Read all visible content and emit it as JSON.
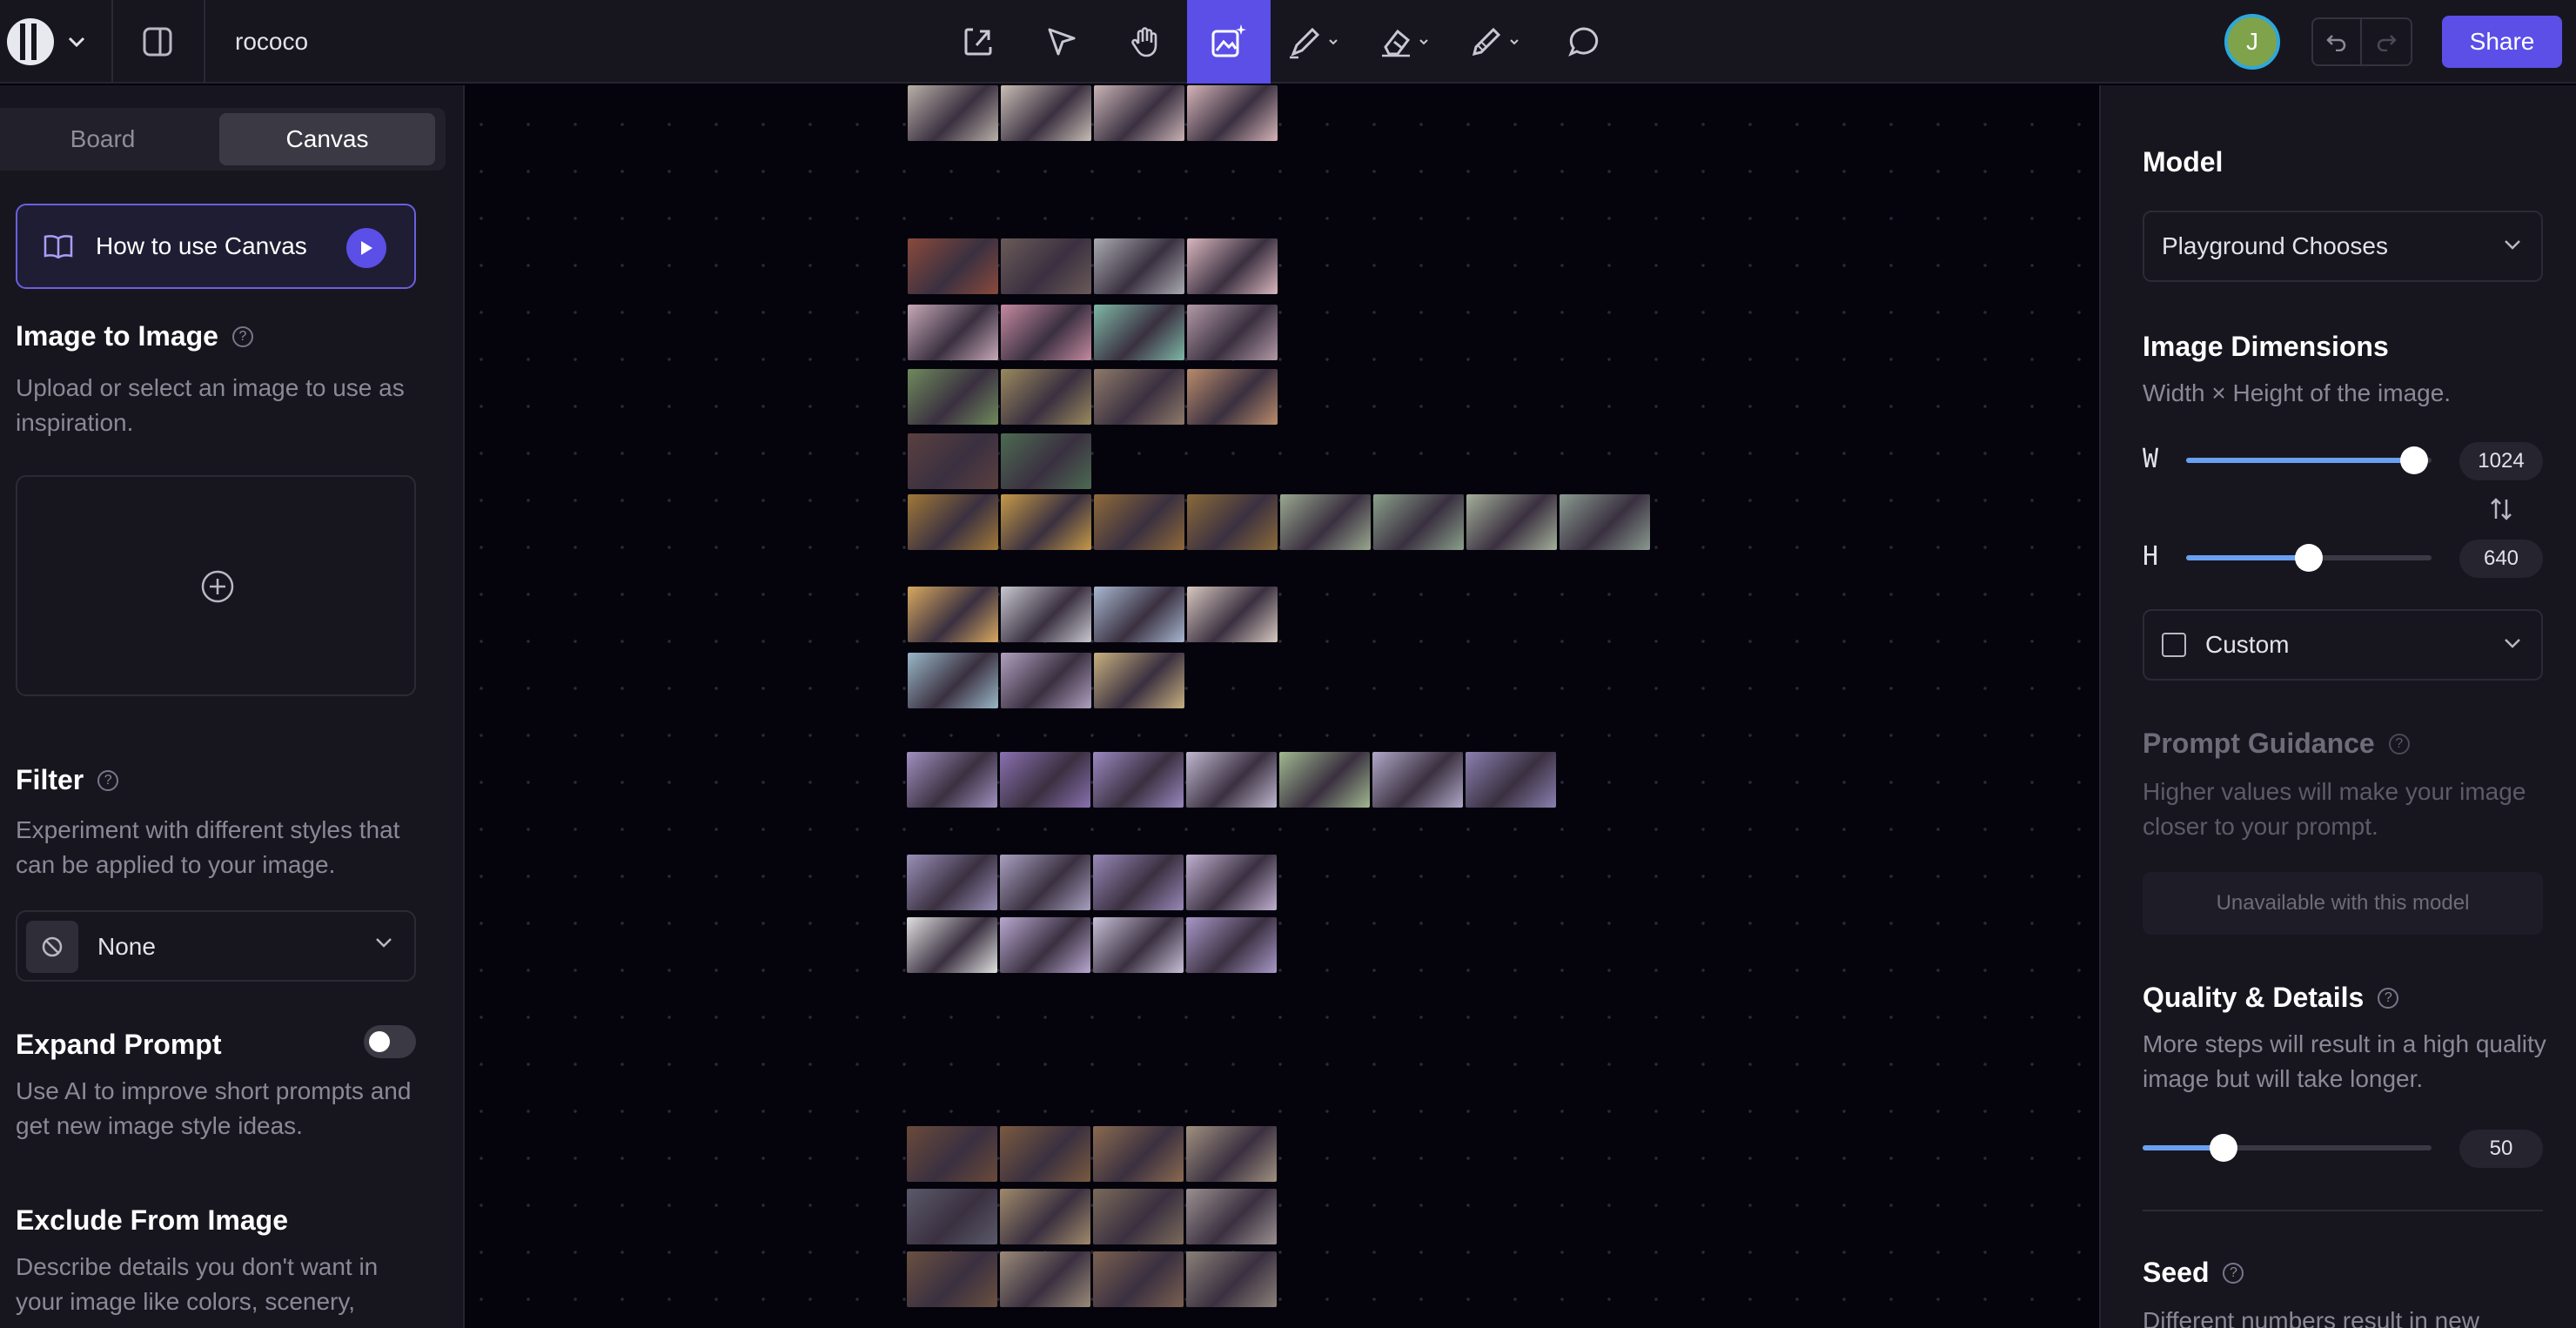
{
  "topbar": {
    "file_name": "rococo",
    "avatar_initial": "J",
    "share_label": "Share",
    "tools": [
      "export-icon",
      "select-arrow-icon",
      "hand-icon",
      "image-generate-icon",
      "pencil-icon",
      "eraser-icon",
      "brush-icon",
      "comment-icon"
    ],
    "active_tool": "image-generate-icon",
    "accent": "#5b4fe8"
  },
  "left_panel": {
    "tabs": [
      "Board",
      "Canvas"
    ],
    "selected_tab": "Canvas",
    "how_to": "How to use Canvas",
    "image_to_image": {
      "title": "Image to Image",
      "desc": "Upload or select an image to use as inspiration."
    },
    "filter": {
      "title": "Filter",
      "desc": "Experiment with different styles that can be applied to your image.",
      "value": "None"
    },
    "expand_prompt": {
      "title": "Expand Prompt",
      "desc": "Use AI to improve short prompts and get new image style ideas.",
      "enabled": false
    },
    "exclude": {
      "title": "Exclude From Image",
      "desc": "Describe details you don't want in your image like colors, scenery,"
    }
  },
  "right_panel": {
    "model": {
      "title": "Model",
      "value": "Playground Chooses"
    },
    "dimensions": {
      "title": "Image Dimensions",
      "desc": "Width × Height of the image.",
      "w_label": "W",
      "h_label": "H",
      "width": "1024",
      "height": "640",
      "width_fraction": 0.93,
      "height_fraction": 0.5,
      "preset": "Custom"
    },
    "prompt_guidance": {
      "title": "Prompt Guidance",
      "desc": "Higher values will make your image closer to your prompt.",
      "unavailable": "Unavailable with this model"
    },
    "quality": {
      "title": "Quality & Details",
      "desc": "More steps will result in a high quality image but will take longer.",
      "steps": "50",
      "fraction": 0.28
    },
    "seed": {
      "title": "Seed",
      "desc": "Different numbers result in new"
    }
  }
}
